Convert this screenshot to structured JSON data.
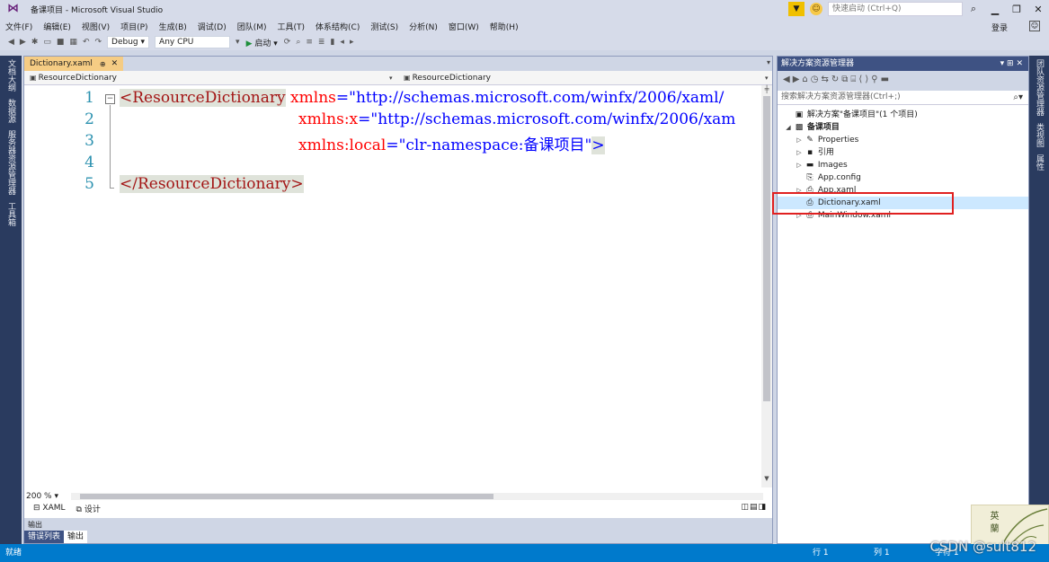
{
  "window": {
    "title": "备课项目 - Microsoft Visual Studio",
    "quick_launch_placeholder": "快速启动 (Ctrl+Q)",
    "login": "登录"
  },
  "menu": [
    "文件(F)",
    "编辑(E)",
    "视图(V)",
    "项目(P)",
    "生成(B)",
    "调试(D)",
    "团队(M)",
    "工具(T)",
    "体系结构(C)",
    "测试(S)",
    "分析(N)",
    "窗口(W)",
    "帮助(H)"
  ],
  "toolbar": {
    "config": "Debug",
    "platform": "Any CPU",
    "start": "启动"
  },
  "left_rail": [
    "文档大纲",
    "数据源",
    "服务器资源管理器",
    "工具箱"
  ],
  "right_rail": [
    "团队资源管理器",
    "类视图",
    "属性"
  ],
  "editor": {
    "tab_title": "Dictionary.xaml",
    "nav_left": "ResourceDictionary",
    "nav_right": "ResourceDictionary",
    "lines": [
      {
        "no": "1",
        "tag_open": "<ResourceDictionary",
        "attr": "xmlns",
        "eq": "=",
        "value": "\"http://schemas.microsoft.com/winfx/2006/xaml/"
      },
      {
        "no": "2",
        "attr": "xmlns:x",
        "eq": "=",
        "value": "\"http://schemas.microsoft.com/winfx/2006/xam"
      },
      {
        "no": "3",
        "attr": "xmlns:local",
        "eq": "=",
        "value": "\"clr-namespace:备课项目\"",
        "close": ">"
      },
      {
        "no": "4"
      },
      {
        "no": "5",
        "tag_close": "</ResourceDictionary>"
      }
    ],
    "zoom": "200 %",
    "view_tabs": [
      "XAML",
      "设计"
    ],
    "output_title": "输出",
    "output_tabs": [
      "错误列表",
      "输出"
    ]
  },
  "solution_explorer": {
    "title": "解决方案资源管理器",
    "search_placeholder": "搜索解决方案资源管理器(Ctrl+;)",
    "tree": [
      {
        "label": "解决方案\"备课项目\"(1 个项目)",
        "icon": "solution-icon",
        "expander": "",
        "indent": 0
      },
      {
        "label": "备课项目",
        "icon": "csharp-project-icon",
        "expander": "◢",
        "indent": 0,
        "bold": true
      },
      {
        "label": "Properties",
        "icon": "wrench-icon",
        "expander": "▷",
        "indent": 1
      },
      {
        "label": "引用",
        "icon": "references-icon",
        "expander": "▷",
        "indent": 1
      },
      {
        "label": "Images",
        "icon": "folder-icon",
        "expander": "▷",
        "indent": 1
      },
      {
        "label": "App.config",
        "icon": "config-file-icon",
        "expander": "",
        "indent": 1
      },
      {
        "label": "App.xaml",
        "icon": "xaml-file-icon",
        "expander": "▷",
        "indent": 1
      },
      {
        "label": "Dictionary.xaml",
        "icon": "xaml-file-icon",
        "expander": "",
        "indent": 1,
        "selected": true
      },
      {
        "label": "MainWindow.xaml",
        "icon": "xaml-file-icon",
        "expander": "▷",
        "indent": 1
      }
    ]
  },
  "status": {
    "text": "就绪",
    "row": "行 1",
    "col": "列 1",
    "char": "字符 1"
  },
  "watermark": "CSDN @sult812",
  "decoration_text": "英蘭"
}
